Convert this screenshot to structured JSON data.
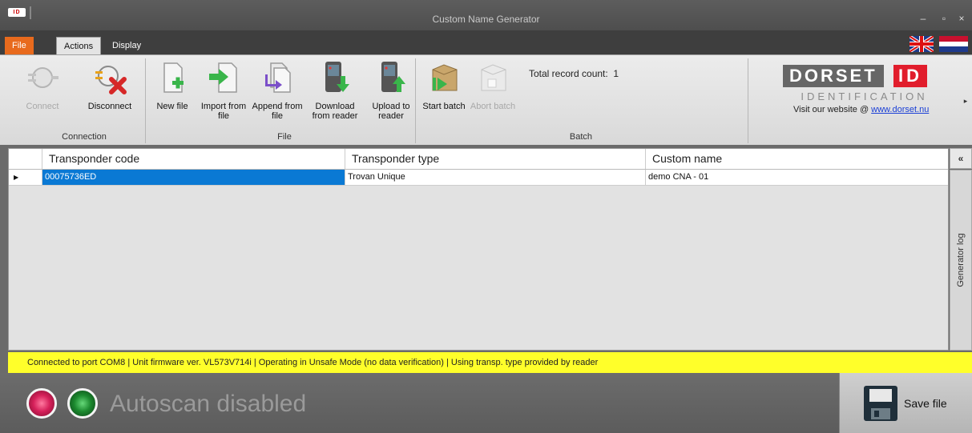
{
  "window": {
    "logo_text": "ID",
    "title": "Custom Name Generator",
    "minimize_glyph": "‒",
    "maximize_glyph": "▫",
    "close_glyph": "×"
  },
  "tabs": {
    "file": "File",
    "actions": "Actions",
    "display": "Display"
  },
  "ribbon": {
    "connect": "Connect",
    "disconnect": "Disconnect",
    "connection_group": "Connection",
    "new_file": "New file",
    "import_from_file": "Import from file",
    "append_from_file": "Append from file",
    "download_from_reader": "Download from reader",
    "upload_to_reader": "Upload to reader",
    "file_group": "File",
    "start_batch": "Start batch",
    "abort_batch": "Abort batch",
    "batch_group": "Batch",
    "record_count_label": "Total record count:",
    "record_count_value": "1",
    "logo_word": "DORSET",
    "logo_id": "ID",
    "logo_sub": "IDENTIFICATION",
    "visit_prefix": "Visit our website @ ",
    "visit_link": "www.dorset.nu",
    "scroll_glyph": "▸"
  },
  "grid": {
    "columns": [
      "Transponder code",
      "Transponder type",
      "Custom name"
    ],
    "rows": [
      {
        "indicator": "▶",
        "code": "00075736ED",
        "type": "Trovan Unique",
        "name": "demo CNA - 01"
      }
    ]
  },
  "side": {
    "collapse": "«",
    "panel_label": "Generator log"
  },
  "status": {
    "text": "Connected to port COM8 | Unit firmware ver. VL573V714i | Operating in Unsafe Mode (no data verification) | Using transp. type provided by reader"
  },
  "bottom": {
    "autoscan": "Autoscan disabled",
    "save_file": "Save file"
  },
  "colors": {
    "accent_orange": "#e86a1d",
    "selection_blue": "#0a79d4",
    "status_yellow": "#ffff2a",
    "brand_red": "#e11d2c"
  },
  "icons": [
    "plug-icon",
    "disconnect-icon",
    "new-file-icon",
    "import-icon",
    "append-icon",
    "download-icon",
    "upload-icon",
    "start-batch-icon",
    "abort-batch-icon",
    "save-disk-icon"
  ]
}
